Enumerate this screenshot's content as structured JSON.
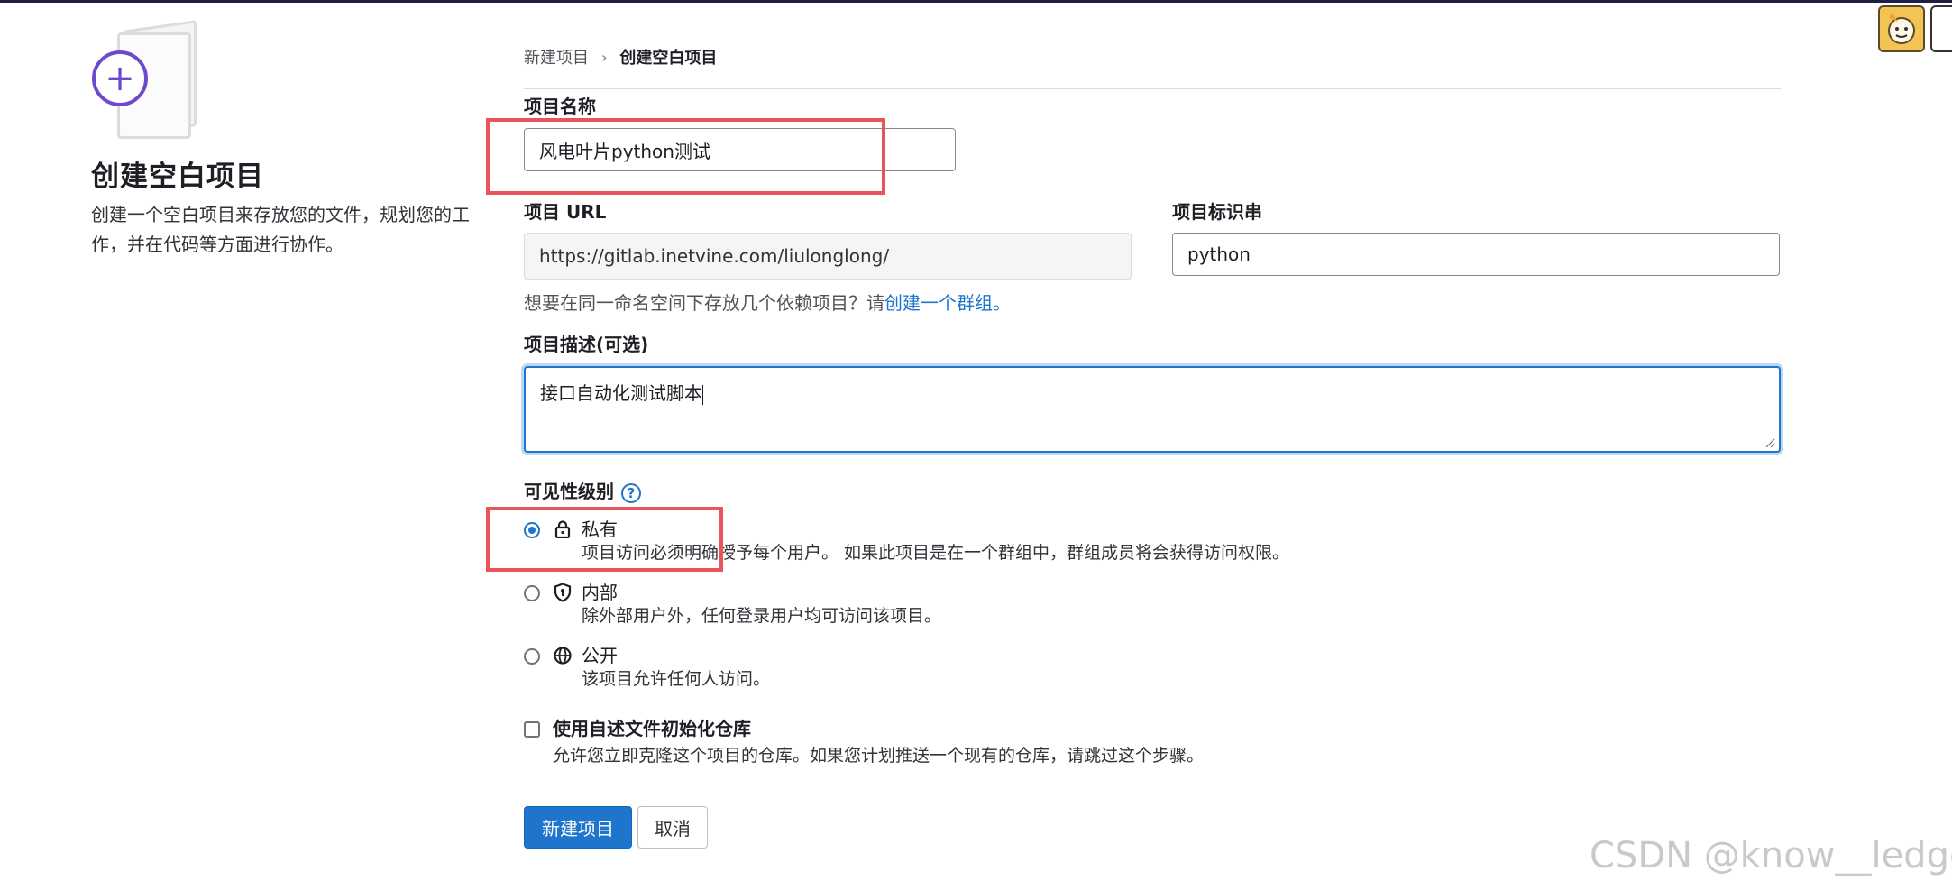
{
  "sidebar": {
    "title": "创建空白项目",
    "description": "创建一个空白项目来存放您的文件，规划您的工作，并在代码等方面进行协作。"
  },
  "breadcrumb": {
    "parent": "新建项目",
    "current": "创建空白项目"
  },
  "form": {
    "project_name": {
      "label": "项目名称",
      "value": "风电叶片python测试"
    },
    "project_url": {
      "label": "项目 URL",
      "value": "https://gitlab.inetvine.com/liulonglong/"
    },
    "project_slug": {
      "label": "项目标识串",
      "value": "python"
    },
    "group_help": {
      "text": "想要在同一命名空间下存放几个依赖项目？请",
      "link": "创建一个群组。"
    },
    "description": {
      "label": "项目描述(可选)",
      "value": "接口自动化测试脚本"
    },
    "visibility": {
      "label": "可见性级别",
      "options": [
        {
          "title": "私有",
          "icon": "lock-icon",
          "desc": "项目访问必须明确授予每个用户。 如果此项目是在一个群组中，群组成员将会获得访问权限。",
          "selected": true
        },
        {
          "title": "内部",
          "icon": "shield-icon",
          "desc": "除外部用户外，任何登录用户均可访问该项目。",
          "selected": false
        },
        {
          "title": "公开",
          "icon": "globe-icon",
          "desc": "该项目允许任何人访问。",
          "selected": false
        }
      ]
    },
    "readme": {
      "title": "使用自述文件初始化仓库",
      "desc": "允许您立即克隆这个项目的仓库。如果您计划推送一个现有的仓库，请跳过这个步骤。",
      "checked": false
    },
    "submit_label": "新建项目",
    "cancel_label": "取消"
  },
  "watermark": "CSDN @know__ledge",
  "colors": {
    "accent": "#1f75cb",
    "annotation": "#e9545a",
    "illustration": "#6e49cb"
  }
}
